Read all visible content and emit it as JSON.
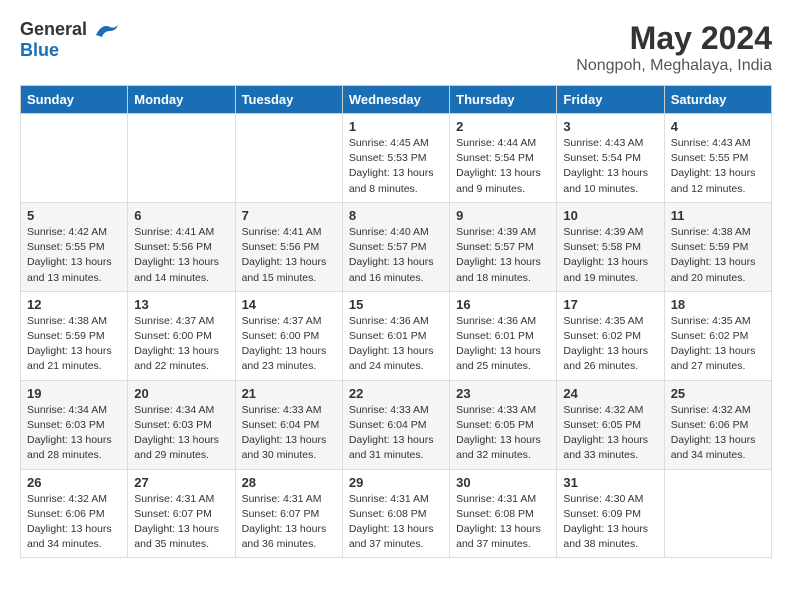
{
  "header": {
    "logo_general": "General",
    "logo_blue": "Blue",
    "title": "May 2024",
    "subtitle": "Nongpoh, Meghalaya, India"
  },
  "days_of_week": [
    "Sunday",
    "Monday",
    "Tuesday",
    "Wednesday",
    "Thursday",
    "Friday",
    "Saturday"
  ],
  "weeks": [
    [
      {
        "day": "",
        "info": ""
      },
      {
        "day": "",
        "info": ""
      },
      {
        "day": "",
        "info": ""
      },
      {
        "day": "1",
        "info": "Sunrise: 4:45 AM\nSunset: 5:53 PM\nDaylight: 13 hours\nand 8 minutes."
      },
      {
        "day": "2",
        "info": "Sunrise: 4:44 AM\nSunset: 5:54 PM\nDaylight: 13 hours\nand 9 minutes."
      },
      {
        "day": "3",
        "info": "Sunrise: 4:43 AM\nSunset: 5:54 PM\nDaylight: 13 hours\nand 10 minutes."
      },
      {
        "day": "4",
        "info": "Sunrise: 4:43 AM\nSunset: 5:55 PM\nDaylight: 13 hours\nand 12 minutes."
      }
    ],
    [
      {
        "day": "5",
        "info": "Sunrise: 4:42 AM\nSunset: 5:55 PM\nDaylight: 13 hours\nand 13 minutes."
      },
      {
        "day": "6",
        "info": "Sunrise: 4:41 AM\nSunset: 5:56 PM\nDaylight: 13 hours\nand 14 minutes."
      },
      {
        "day": "7",
        "info": "Sunrise: 4:41 AM\nSunset: 5:56 PM\nDaylight: 13 hours\nand 15 minutes."
      },
      {
        "day": "8",
        "info": "Sunrise: 4:40 AM\nSunset: 5:57 PM\nDaylight: 13 hours\nand 16 minutes."
      },
      {
        "day": "9",
        "info": "Sunrise: 4:39 AM\nSunset: 5:57 PM\nDaylight: 13 hours\nand 18 minutes."
      },
      {
        "day": "10",
        "info": "Sunrise: 4:39 AM\nSunset: 5:58 PM\nDaylight: 13 hours\nand 19 minutes."
      },
      {
        "day": "11",
        "info": "Sunrise: 4:38 AM\nSunset: 5:59 PM\nDaylight: 13 hours\nand 20 minutes."
      }
    ],
    [
      {
        "day": "12",
        "info": "Sunrise: 4:38 AM\nSunset: 5:59 PM\nDaylight: 13 hours\nand 21 minutes."
      },
      {
        "day": "13",
        "info": "Sunrise: 4:37 AM\nSunset: 6:00 PM\nDaylight: 13 hours\nand 22 minutes."
      },
      {
        "day": "14",
        "info": "Sunrise: 4:37 AM\nSunset: 6:00 PM\nDaylight: 13 hours\nand 23 minutes."
      },
      {
        "day": "15",
        "info": "Sunrise: 4:36 AM\nSunset: 6:01 PM\nDaylight: 13 hours\nand 24 minutes."
      },
      {
        "day": "16",
        "info": "Sunrise: 4:36 AM\nSunset: 6:01 PM\nDaylight: 13 hours\nand 25 minutes."
      },
      {
        "day": "17",
        "info": "Sunrise: 4:35 AM\nSunset: 6:02 PM\nDaylight: 13 hours\nand 26 minutes."
      },
      {
        "day": "18",
        "info": "Sunrise: 4:35 AM\nSunset: 6:02 PM\nDaylight: 13 hours\nand 27 minutes."
      }
    ],
    [
      {
        "day": "19",
        "info": "Sunrise: 4:34 AM\nSunset: 6:03 PM\nDaylight: 13 hours\nand 28 minutes."
      },
      {
        "day": "20",
        "info": "Sunrise: 4:34 AM\nSunset: 6:03 PM\nDaylight: 13 hours\nand 29 minutes."
      },
      {
        "day": "21",
        "info": "Sunrise: 4:33 AM\nSunset: 6:04 PM\nDaylight: 13 hours\nand 30 minutes."
      },
      {
        "day": "22",
        "info": "Sunrise: 4:33 AM\nSunset: 6:04 PM\nDaylight: 13 hours\nand 31 minutes."
      },
      {
        "day": "23",
        "info": "Sunrise: 4:33 AM\nSunset: 6:05 PM\nDaylight: 13 hours\nand 32 minutes."
      },
      {
        "day": "24",
        "info": "Sunrise: 4:32 AM\nSunset: 6:05 PM\nDaylight: 13 hours\nand 33 minutes."
      },
      {
        "day": "25",
        "info": "Sunrise: 4:32 AM\nSunset: 6:06 PM\nDaylight: 13 hours\nand 34 minutes."
      }
    ],
    [
      {
        "day": "26",
        "info": "Sunrise: 4:32 AM\nSunset: 6:06 PM\nDaylight: 13 hours\nand 34 minutes."
      },
      {
        "day": "27",
        "info": "Sunrise: 4:31 AM\nSunset: 6:07 PM\nDaylight: 13 hours\nand 35 minutes."
      },
      {
        "day": "28",
        "info": "Sunrise: 4:31 AM\nSunset: 6:07 PM\nDaylight: 13 hours\nand 36 minutes."
      },
      {
        "day": "29",
        "info": "Sunrise: 4:31 AM\nSunset: 6:08 PM\nDaylight: 13 hours\nand 37 minutes."
      },
      {
        "day": "30",
        "info": "Sunrise: 4:31 AM\nSunset: 6:08 PM\nDaylight: 13 hours\nand 37 minutes."
      },
      {
        "day": "31",
        "info": "Sunrise: 4:30 AM\nSunset: 6:09 PM\nDaylight: 13 hours\nand 38 minutes."
      },
      {
        "day": "",
        "info": ""
      }
    ]
  ]
}
